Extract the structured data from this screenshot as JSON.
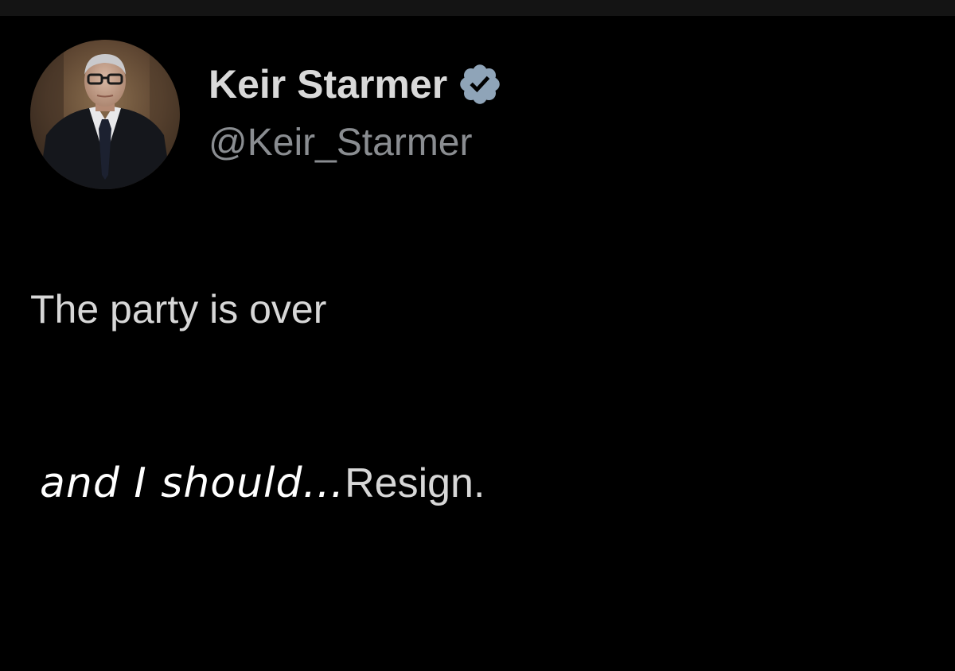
{
  "tweet": {
    "author": {
      "display_name": "Keir Starmer",
      "handle": "@Keir_Starmer",
      "verified": true,
      "verified_icon": "verified-badge-icon",
      "verified_color": "#8fa4b8"
    },
    "text": "The party is over",
    "edit_overlay": {
      "handwritten_part": "and I should...",
      "typed_part": "Resign."
    }
  },
  "colors": {
    "background": "#000000",
    "name_text": "#d9d9d9",
    "handle_text": "#8a8d91",
    "body_text": "#d7d7d7",
    "handwriting": "#ffffff"
  }
}
